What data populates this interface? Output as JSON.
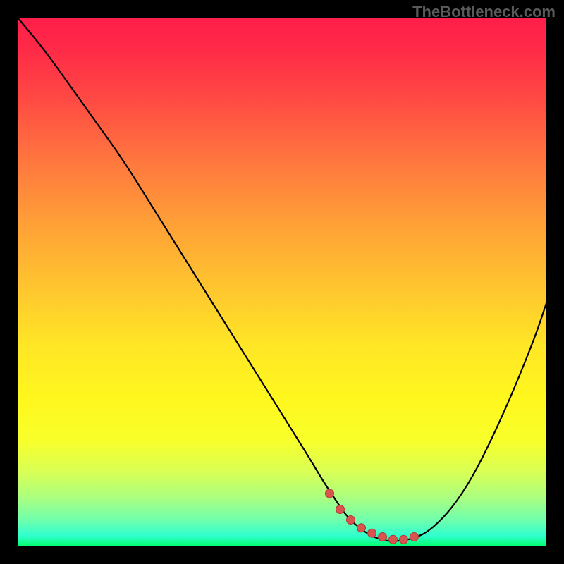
{
  "watermark": "TheBottleneck.com",
  "colors": {
    "curve": "#000000",
    "marker_fill": "#d9534f",
    "marker_stroke": "#b03a36"
  },
  "chart_data": {
    "type": "line",
    "title": "",
    "xlabel": "",
    "ylabel": "",
    "xlim": [
      0,
      100
    ],
    "ylim": [
      0,
      100
    ],
    "x": [
      0,
      5,
      10,
      15,
      20,
      25,
      30,
      35,
      40,
      45,
      50,
      55,
      58,
      60,
      62,
      64,
      66,
      68,
      70,
      72,
      75,
      78,
      82,
      86,
      90,
      94,
      98,
      100
    ],
    "y": [
      100,
      94,
      87,
      80,
      73,
      65,
      57,
      49,
      41,
      33,
      25,
      17,
      12,
      9,
      6,
      4,
      2.5,
      1.5,
      1,
      1,
      1.5,
      3,
      7,
      13,
      21,
      30,
      40,
      46
    ],
    "markers": {
      "x": [
        59,
        61,
        63,
        65,
        67,
        69,
        71,
        73,
        75
      ],
      "y": [
        10,
        7,
        5,
        3.5,
        2.5,
        1.8,
        1.3,
        1.3,
        1.8
      ],
      "radius": 6
    }
  }
}
